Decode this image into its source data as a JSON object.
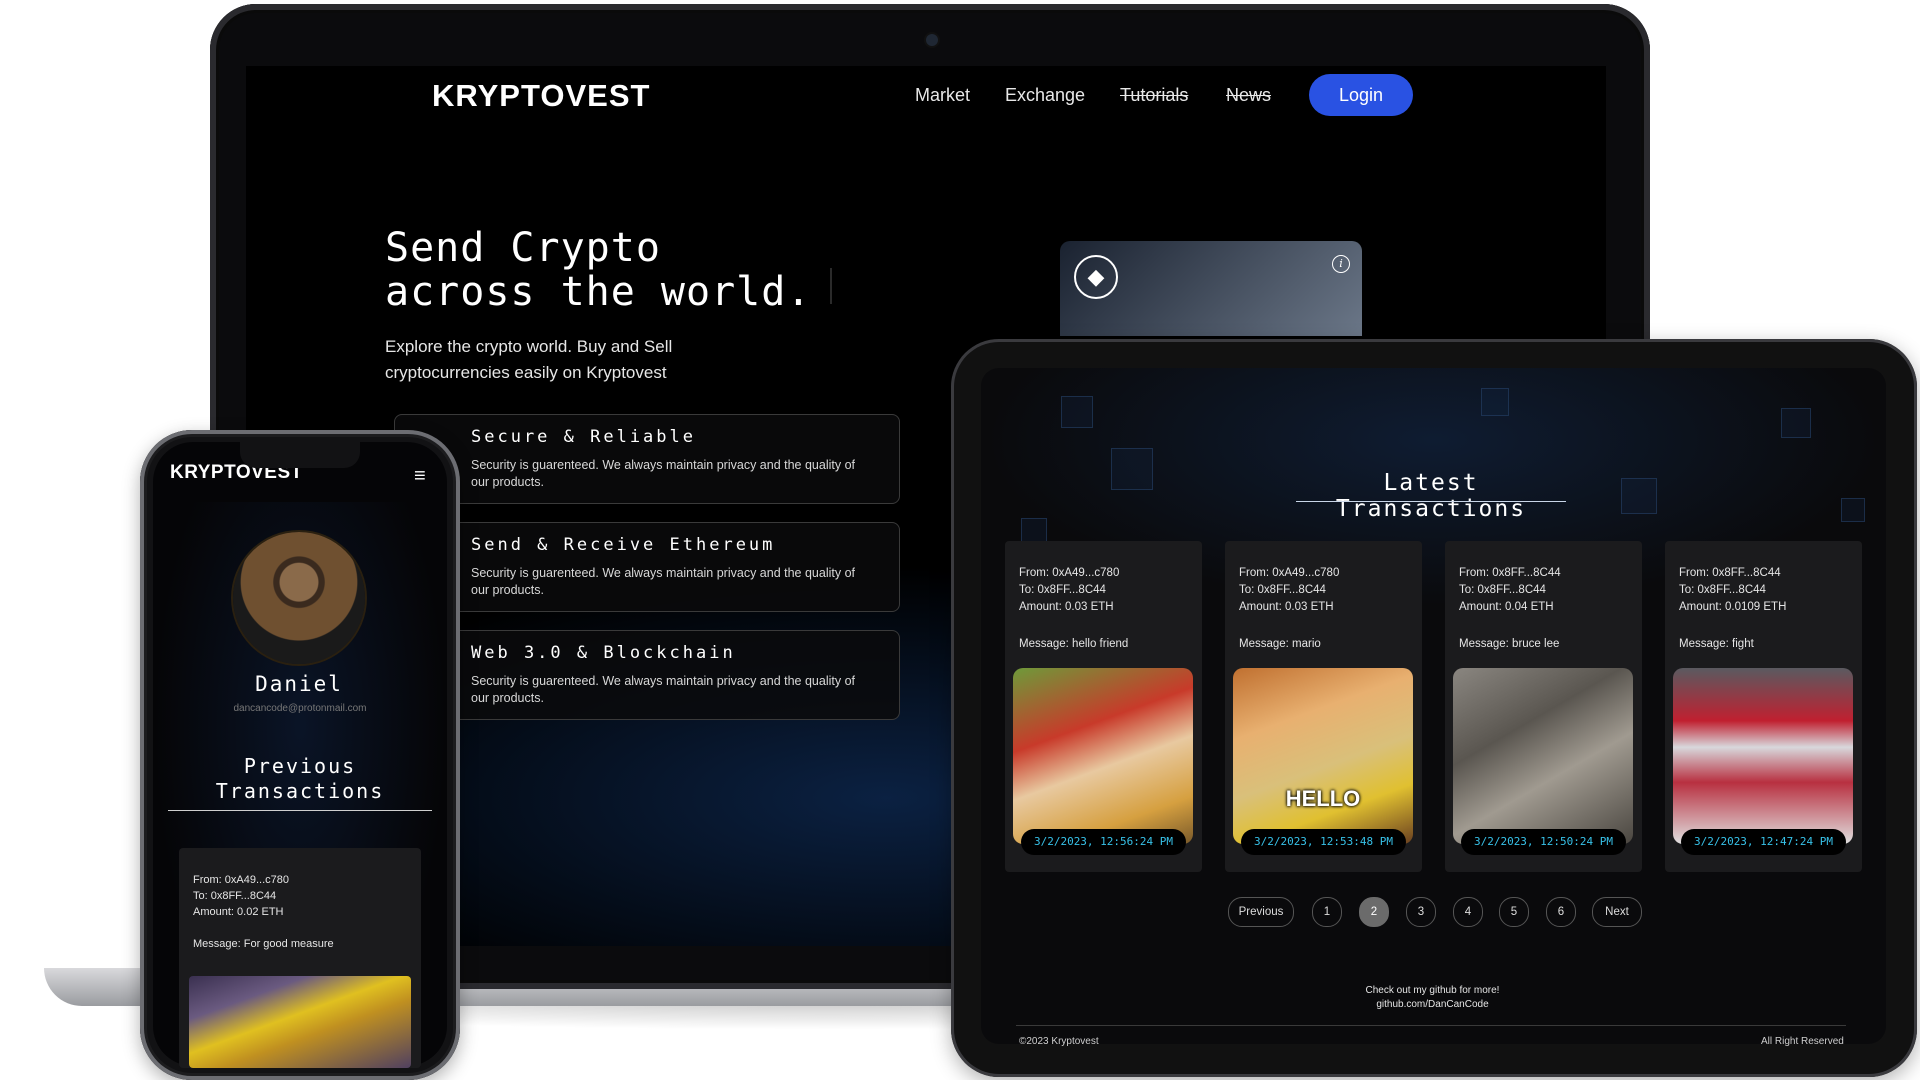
{
  "laptop": {
    "brand": "KRYPTOVEST",
    "nav": [
      {
        "label": "Market",
        "struck": false
      },
      {
        "label": "Exchange",
        "struck": false
      },
      {
        "label": "Tutorials",
        "struck": true
      },
      {
        "label": "News",
        "struck": true
      }
    ],
    "login_label": "Login",
    "hero_title": "Send Crypto\nacross the world.",
    "hero_subtitle": "Explore the crypto world. Buy and Sell cryptocurrencies easily on Kryptovest",
    "features": [
      {
        "title": "Secure & Reliable",
        "description": "Security is guarenteed. We always maintain privacy and the quality of our products."
      },
      {
        "title": "Send & Receive Ethereum",
        "description": "Security is guarenteed. We always maintain privacy and the quality of our products."
      },
      {
        "title": "Web 3.0 & Blockchain",
        "description": "Security is guarenteed. We always maintain privacy and the quality of our products."
      }
    ],
    "eth_symbol": "◆",
    "info_symbol": "i"
  },
  "tablet": {
    "heading": "Latest Transactions",
    "transactions": [
      {
        "from": "From: 0xA49...c780",
        "to": "To: 0x8FF...8C44",
        "amount": "Amount: 0.03 ETH",
        "message": "Message: hello friend",
        "time": "3/2/2023, 12:56:24 PM",
        "gif_caption": ""
      },
      {
        "from": "From: 0xA49...c780",
        "to": "To: 0x8FF...8C44",
        "amount": "Amount: 0.03 ETH",
        "message": "Message: mario",
        "time": "3/2/2023, 12:53:48 PM",
        "gif_caption": "HELLO"
      },
      {
        "from": "From: 0x8FF...8C44",
        "to": "To: 0x8FF...8C44",
        "amount": "Amount: 0.04 ETH",
        "message": "Message: bruce lee",
        "time": "3/2/2023, 12:50:24 PM",
        "gif_caption": ""
      },
      {
        "from": "From: 0x8FF...8C44",
        "to": "To: 0x8FF...8C44",
        "amount": "Amount: 0.0109 ETH",
        "message": "Message: fight",
        "time": "3/2/2023, 12:47:24 PM",
        "gif_caption": ""
      }
    ],
    "pagination": {
      "previous": "Previous",
      "pages": [
        "1",
        "2",
        "3",
        "4",
        "5",
        "6"
      ],
      "active_page": "2",
      "next": "Next"
    },
    "footer_line1": "Check out my github for more!",
    "footer_line2": "github.com/DanCanCode",
    "copyright": "©2023 Kryptovest",
    "rights": "All Right Reserved"
  },
  "phone": {
    "brand": "KRYPTOVEST",
    "menu_icon": "≡",
    "user_name": "Daniel",
    "user_email": "dancancode@protonmail.com",
    "section_title": "Previous\nTransactions",
    "transaction": {
      "from": "From: 0xA49...c780",
      "to": "To: 0x8FF...8C44",
      "amount": "Amount: 0.02 ETH",
      "message": "Message: For good measure"
    }
  },
  "colors": {
    "accent": "#2952e3",
    "timestamp": "#37c1e8",
    "card_bg": "#1b1b1d"
  }
}
